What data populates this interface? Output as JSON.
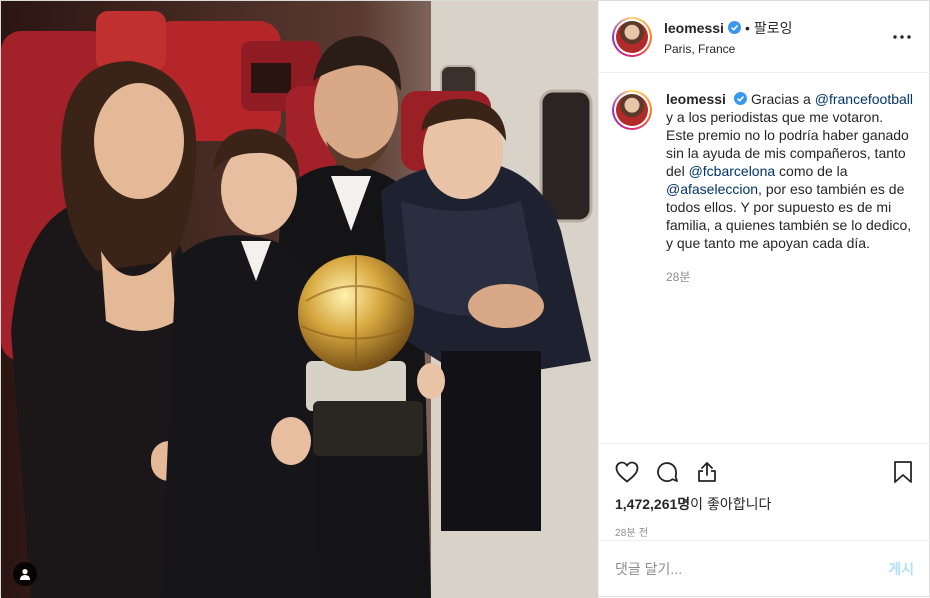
{
  "post": {
    "username": "leomessi",
    "follow_label": "팔로잉",
    "separator": "•",
    "location": "Paris, France",
    "more_icon": "more-horizontal-icon",
    "verified_icon": "verified-badge-icon"
  },
  "caption": {
    "username": "leomessi",
    "parts": {
      "t1": "Gracias a ",
      "m1": "@francefootball",
      "t2": " y a los periodistas que me votaron. Este premio no lo podría haber ganado sin la ayuda de mis compañeros, tanto del ",
      "m2": "@fcbarcelona",
      "t3": " como de la ",
      "m3": "@afaseleccion",
      "t4": ", por eso también es de todos ellos. Y por supuesto es de mi familia, a quienes también se lo dedico, y que tanto me apoyan cada día."
    },
    "age": "28분"
  },
  "actions": {
    "like_icon": "heart-icon",
    "comment_icon": "comment-icon",
    "share_icon": "share-icon",
    "save_icon": "bookmark-icon"
  },
  "likes": {
    "count": "1,472,261명",
    "suffix": "이 좋아합니다"
  },
  "timestamp": "28분 전",
  "comment_box": {
    "placeholder": "댓글 달기...",
    "post_label": "게시"
  },
  "photo": {
    "tag_icon": "user-tag-icon",
    "description_colors": {
      "seats": "#b5262a",
      "trophy": "#c8a24a",
      "background": "#3a1d18"
    }
  }
}
